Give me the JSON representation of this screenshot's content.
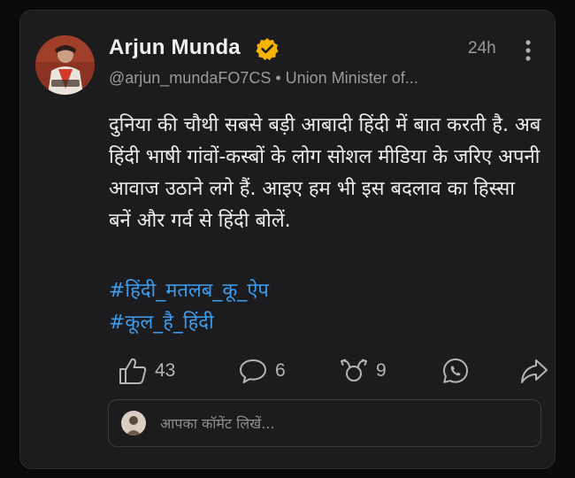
{
  "post": {
    "author": {
      "name": "Arjun Munda",
      "verified": true,
      "handle_line": "@arjun_mundaFO7CS • Union Minister of..."
    },
    "time": "24h",
    "text": "दुनिया की चौथी सबसे बड़ी आबादी हिंदी में बात करती है. अब हिंदी भाषी गांवों-कस्बों के लोग सोशल मीडिया के जरिए अपनी आवाज उठाने लगे हैं. आइए हम भी इस बदलाव का हिस्सा बनें और गर्व से हिंदी बोलें.",
    "hashtags": [
      "#हिंदी_मतलब_कू_ऐप",
      "#कूल_है_हिंदी"
    ]
  },
  "actions": {
    "likes": "43",
    "comments": "6",
    "rekoos": "9"
  },
  "comment_box": {
    "placeholder": "आपका कॉमेंट लिखें..."
  },
  "colors": {
    "card_bg": "#1c1c1e",
    "hashtag": "#3b9cf0",
    "verified_badge": "#f5b400",
    "muted_text": "#9a9a9a"
  },
  "icons": [
    "verified-badge-icon",
    "more-vertical-icon",
    "like-icon",
    "comment-icon",
    "rekoo-icon",
    "whatsapp-icon",
    "share-icon"
  ]
}
